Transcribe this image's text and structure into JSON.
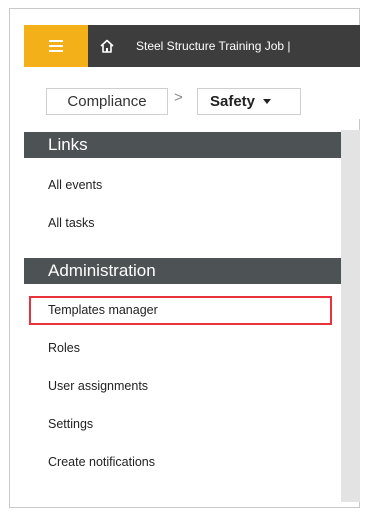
{
  "topbar": {
    "menu_icon": "hamburger-menu-icon",
    "home_icon": "home-icon",
    "job_title": "Steel Structure Training Job |",
    "accent_color": "#f3b019",
    "bar_color": "#3d3d3d"
  },
  "breadcrumb": {
    "parent": "Compliance",
    "separator": ">",
    "current": "Safety"
  },
  "sidebar": {
    "links_header": "Links",
    "links": [
      {
        "label": "All events"
      },
      {
        "label": "All tasks"
      }
    ],
    "admin_header": "Administration",
    "admin_items": [
      {
        "label": "Templates manager",
        "highlighted": true
      },
      {
        "label": "Roles"
      },
      {
        "label": "User assignments"
      },
      {
        "label": "Settings"
      },
      {
        "label": "Create notifications"
      }
    ],
    "header_color": "#4d5255",
    "highlight_color": "#e8333c"
  }
}
